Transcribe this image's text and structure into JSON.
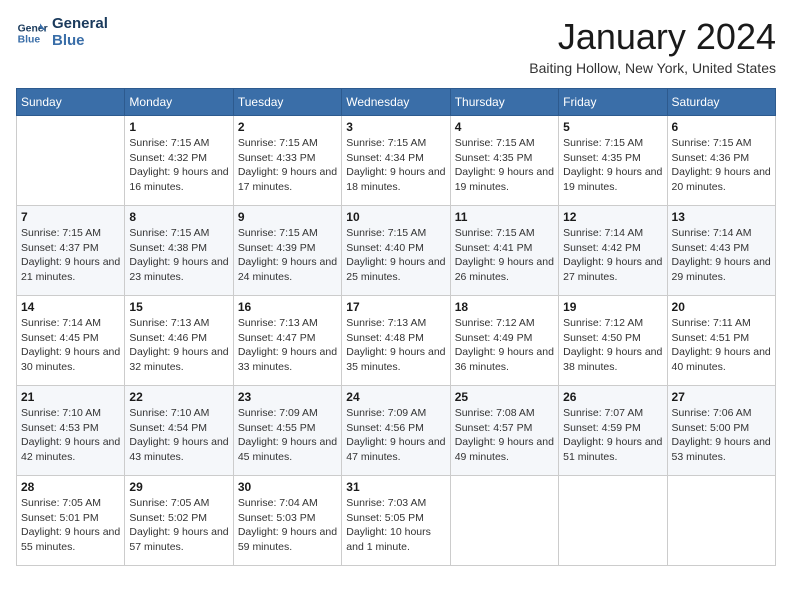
{
  "header": {
    "logo_line1": "General",
    "logo_line2": "Blue",
    "month_title": "January 2024",
    "location": "Baiting Hollow, New York, United States"
  },
  "columns": [
    "Sunday",
    "Monday",
    "Tuesday",
    "Wednesday",
    "Thursday",
    "Friday",
    "Saturday"
  ],
  "weeks": [
    [
      {
        "day": "",
        "sunrise": "",
        "sunset": "",
        "daylight": ""
      },
      {
        "day": "1",
        "sunrise": "Sunrise: 7:15 AM",
        "sunset": "Sunset: 4:32 PM",
        "daylight": "Daylight: 9 hours and 16 minutes."
      },
      {
        "day": "2",
        "sunrise": "Sunrise: 7:15 AM",
        "sunset": "Sunset: 4:33 PM",
        "daylight": "Daylight: 9 hours and 17 minutes."
      },
      {
        "day": "3",
        "sunrise": "Sunrise: 7:15 AM",
        "sunset": "Sunset: 4:34 PM",
        "daylight": "Daylight: 9 hours and 18 minutes."
      },
      {
        "day": "4",
        "sunrise": "Sunrise: 7:15 AM",
        "sunset": "Sunset: 4:35 PM",
        "daylight": "Daylight: 9 hours and 19 minutes."
      },
      {
        "day": "5",
        "sunrise": "Sunrise: 7:15 AM",
        "sunset": "Sunset: 4:35 PM",
        "daylight": "Daylight: 9 hours and 19 minutes."
      },
      {
        "day": "6",
        "sunrise": "Sunrise: 7:15 AM",
        "sunset": "Sunset: 4:36 PM",
        "daylight": "Daylight: 9 hours and 20 minutes."
      }
    ],
    [
      {
        "day": "7",
        "sunrise": "Sunrise: 7:15 AM",
        "sunset": "Sunset: 4:37 PM",
        "daylight": "Daylight: 9 hours and 21 minutes."
      },
      {
        "day": "8",
        "sunrise": "Sunrise: 7:15 AM",
        "sunset": "Sunset: 4:38 PM",
        "daylight": "Daylight: 9 hours and 23 minutes."
      },
      {
        "day": "9",
        "sunrise": "Sunrise: 7:15 AM",
        "sunset": "Sunset: 4:39 PM",
        "daylight": "Daylight: 9 hours and 24 minutes."
      },
      {
        "day": "10",
        "sunrise": "Sunrise: 7:15 AM",
        "sunset": "Sunset: 4:40 PM",
        "daylight": "Daylight: 9 hours and 25 minutes."
      },
      {
        "day": "11",
        "sunrise": "Sunrise: 7:15 AM",
        "sunset": "Sunset: 4:41 PM",
        "daylight": "Daylight: 9 hours and 26 minutes."
      },
      {
        "day": "12",
        "sunrise": "Sunrise: 7:14 AM",
        "sunset": "Sunset: 4:42 PM",
        "daylight": "Daylight: 9 hours and 27 minutes."
      },
      {
        "day": "13",
        "sunrise": "Sunrise: 7:14 AM",
        "sunset": "Sunset: 4:43 PM",
        "daylight": "Daylight: 9 hours and 29 minutes."
      }
    ],
    [
      {
        "day": "14",
        "sunrise": "Sunrise: 7:14 AM",
        "sunset": "Sunset: 4:45 PM",
        "daylight": "Daylight: 9 hours and 30 minutes."
      },
      {
        "day": "15",
        "sunrise": "Sunrise: 7:13 AM",
        "sunset": "Sunset: 4:46 PM",
        "daylight": "Daylight: 9 hours and 32 minutes."
      },
      {
        "day": "16",
        "sunrise": "Sunrise: 7:13 AM",
        "sunset": "Sunset: 4:47 PM",
        "daylight": "Daylight: 9 hours and 33 minutes."
      },
      {
        "day": "17",
        "sunrise": "Sunrise: 7:13 AM",
        "sunset": "Sunset: 4:48 PM",
        "daylight": "Daylight: 9 hours and 35 minutes."
      },
      {
        "day": "18",
        "sunrise": "Sunrise: 7:12 AM",
        "sunset": "Sunset: 4:49 PM",
        "daylight": "Daylight: 9 hours and 36 minutes."
      },
      {
        "day": "19",
        "sunrise": "Sunrise: 7:12 AM",
        "sunset": "Sunset: 4:50 PM",
        "daylight": "Daylight: 9 hours and 38 minutes."
      },
      {
        "day": "20",
        "sunrise": "Sunrise: 7:11 AM",
        "sunset": "Sunset: 4:51 PM",
        "daylight": "Daylight: 9 hours and 40 minutes."
      }
    ],
    [
      {
        "day": "21",
        "sunrise": "Sunrise: 7:10 AM",
        "sunset": "Sunset: 4:53 PM",
        "daylight": "Daylight: 9 hours and 42 minutes."
      },
      {
        "day": "22",
        "sunrise": "Sunrise: 7:10 AM",
        "sunset": "Sunset: 4:54 PM",
        "daylight": "Daylight: 9 hours and 43 minutes."
      },
      {
        "day": "23",
        "sunrise": "Sunrise: 7:09 AM",
        "sunset": "Sunset: 4:55 PM",
        "daylight": "Daylight: 9 hours and 45 minutes."
      },
      {
        "day": "24",
        "sunrise": "Sunrise: 7:09 AM",
        "sunset": "Sunset: 4:56 PM",
        "daylight": "Daylight: 9 hours and 47 minutes."
      },
      {
        "day": "25",
        "sunrise": "Sunrise: 7:08 AM",
        "sunset": "Sunset: 4:57 PM",
        "daylight": "Daylight: 9 hours and 49 minutes."
      },
      {
        "day": "26",
        "sunrise": "Sunrise: 7:07 AM",
        "sunset": "Sunset: 4:59 PM",
        "daylight": "Daylight: 9 hours and 51 minutes."
      },
      {
        "day": "27",
        "sunrise": "Sunrise: 7:06 AM",
        "sunset": "Sunset: 5:00 PM",
        "daylight": "Daylight: 9 hours and 53 minutes."
      }
    ],
    [
      {
        "day": "28",
        "sunrise": "Sunrise: 7:05 AM",
        "sunset": "Sunset: 5:01 PM",
        "daylight": "Daylight: 9 hours and 55 minutes."
      },
      {
        "day": "29",
        "sunrise": "Sunrise: 7:05 AM",
        "sunset": "Sunset: 5:02 PM",
        "daylight": "Daylight: 9 hours and 57 minutes."
      },
      {
        "day": "30",
        "sunrise": "Sunrise: 7:04 AM",
        "sunset": "Sunset: 5:03 PM",
        "daylight": "Daylight: 9 hours and 59 minutes."
      },
      {
        "day": "31",
        "sunrise": "Sunrise: 7:03 AM",
        "sunset": "Sunset: 5:05 PM",
        "daylight": "Daylight: 10 hours and 1 minute."
      },
      {
        "day": "",
        "sunrise": "",
        "sunset": "",
        "daylight": ""
      },
      {
        "day": "",
        "sunrise": "",
        "sunset": "",
        "daylight": ""
      },
      {
        "day": "",
        "sunrise": "",
        "sunset": "",
        "daylight": ""
      }
    ]
  ]
}
